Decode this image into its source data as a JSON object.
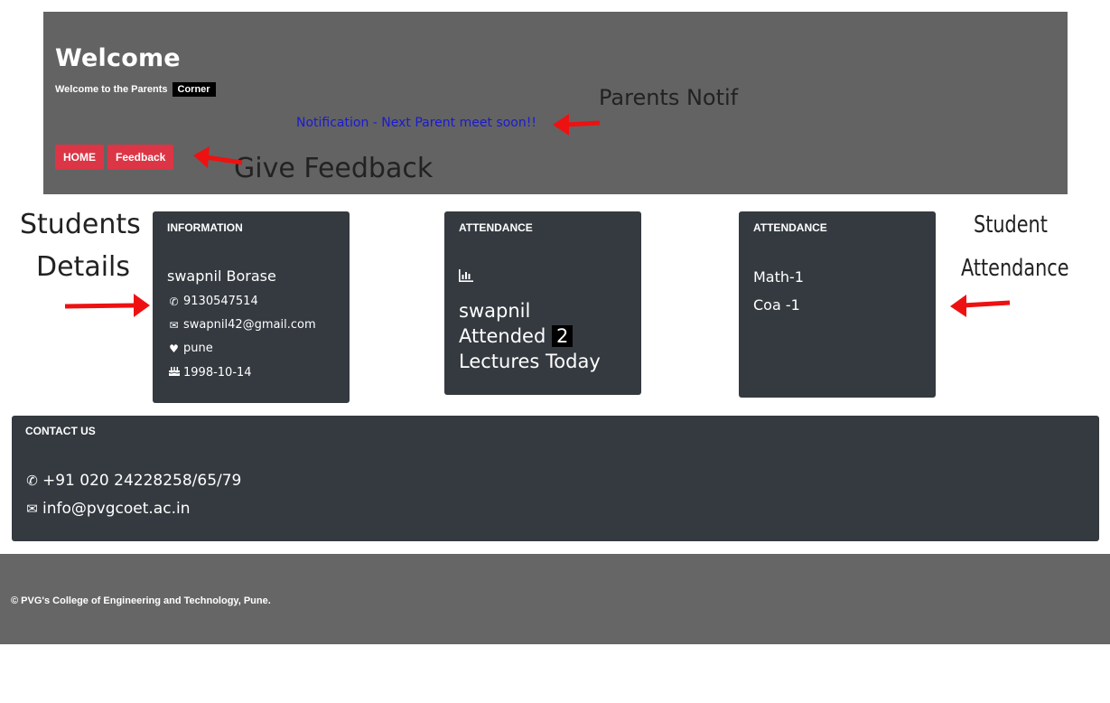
{
  "header": {
    "title": "Welcome",
    "subtitle": "Welcome to the Parents",
    "corner_tag": "Corner",
    "notification": "Notification - Next Parent meet soon!!",
    "buttons": {
      "home": "HOME",
      "feedback": "Feedback"
    }
  },
  "annotations": {
    "parents_notif": "Parents Notif",
    "give_feedback": "Give Feedback",
    "students_details_1": "Students",
    "students_details_2": "Details",
    "student_attendance_1": "Student",
    "student_attendance_2": "Attendance"
  },
  "info_card": {
    "header": "INFORMATION",
    "name": "swapnil Borase",
    "phone": "9130547514",
    "email": "swapnil42@gmail.com",
    "city": "pune",
    "dob": "1998-10-14"
  },
  "attendance_card": {
    "header": "ATTENDANCE",
    "student": "swapnil",
    "attended_label": "Attended",
    "count": "2",
    "suffix": "Lectures Today"
  },
  "subject_card": {
    "header": "ATTENDANCE",
    "subjects": [
      "Math-1",
      "Coa -1"
    ]
  },
  "contact": {
    "header": "CONTACT US",
    "phone": "+91 020 24228258/65/79",
    "email": "info@pvgcoet.ac.in"
  },
  "footer": {
    "text": "© PVG's College of Engineering and Technology, Pune."
  },
  "colors": {
    "header_bg": "#636363",
    "card_bg": "#343a40",
    "button_red": "#dc3545",
    "notification_blue": "#1a1ad4",
    "annotation_arrow": "#ee1111"
  }
}
